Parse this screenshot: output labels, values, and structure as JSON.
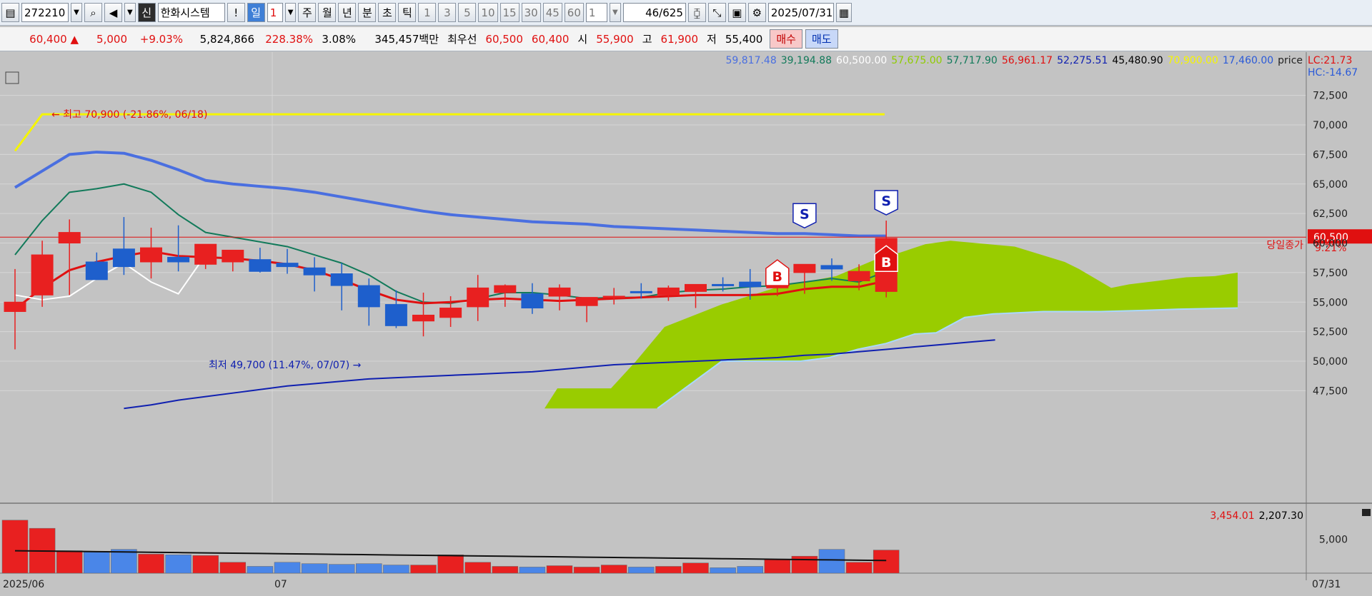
{
  "toolbar": {
    "code": "272210",
    "type_badge": "신",
    "stock_name": "한화시스템",
    "exclaim": "!",
    "period_active": "일",
    "period_count": "1",
    "periods": [
      "주",
      "월",
      "년",
      "분",
      "초",
      "틱"
    ],
    "intervals": [
      "1",
      "3",
      "5",
      "10",
      "15",
      "30",
      "45",
      "60"
    ],
    "interval_value": "1",
    "page_count": "46/625",
    "date": "2025/07/31"
  },
  "info": {
    "price": "60,400",
    "direction": "▲",
    "change": "5,000",
    "change_pct": "+9.03%",
    "volume": "5,824,866",
    "volume_ratio": "228.38%",
    "turnover_pct": "3.08%",
    "amount": "345,457백만",
    "preferred_label": "최우선",
    "ask": "60,500",
    "bid": "60,400",
    "open_label": "시",
    "open": "55,900",
    "high_label": "고",
    "high": "61,900",
    "low_label": "저",
    "low": "55,400",
    "buy_label": "매수",
    "sell_label": "매도"
  },
  "legend": {
    "values": [
      {
        "text": "59,817.48",
        "color": "#4a6fe0"
      },
      {
        "text": "39,194.88",
        "color": "#127a5a"
      },
      {
        "text": "60,500.00",
        "color": "#ffffff"
      },
      {
        "text": "57,675.00",
        "color": "#8fcc00"
      },
      {
        "text": "57,717.90",
        "color": "#127a5a"
      },
      {
        "text": "56,961.17",
        "color": "#e01010"
      },
      {
        "text": "52,275.51",
        "color": "#1020b0"
      },
      {
        "text": "45,480.90",
        "color": "#000000"
      },
      {
        "text": "70,900.00",
        "color": "#f5f500"
      },
      {
        "text": "17,460.00",
        "color": "#2a5ad8"
      }
    ],
    "price_label": "price",
    "lc": "LC:21.73",
    "hc": "HC:-14.67"
  },
  "chart_data": [
    {
      "type": "candlestick",
      "x_labels": [
        "2025/06",
        "07",
        "07/31"
      ],
      "ylim": [
        46000,
        73500
      ],
      "yticks": [
        "72,500",
        "70,000",
        "67,500",
        "65,000",
        "62,500",
        "60,000",
        "57,500",
        "55,000",
        "52,500",
        "50,000",
        "47,500"
      ],
      "candles": [
        {
          "o": 54200,
          "h": 57800,
          "l": 51000,
          "c": 55000
        },
        {
          "o": 55600,
          "h": 60200,
          "l": 54600,
          "c": 59000
        },
        {
          "o": 60000,
          "h": 62000,
          "l": 55600,
          "c": 60900
        },
        {
          "o": 58400,
          "h": 59200,
          "l": 57200,
          "c": 56900
        },
        {
          "o": 59500,
          "h": 62200,
          "l": 57300,
          "c": 58000
        },
        {
          "o": 58400,
          "h": 61300,
          "l": 57000,
          "c": 59600
        },
        {
          "o": 58800,
          "h": 61500,
          "l": 57600,
          "c": 58400
        },
        {
          "o": 58200,
          "h": 59600,
          "l": 57800,
          "c": 59900
        },
        {
          "o": 58400,
          "h": 59400,
          "l": 57600,
          "c": 59400
        },
        {
          "o": 58600,
          "h": 59600,
          "l": 57500,
          "c": 57600
        },
        {
          "o": 58300,
          "h": 59500,
          "l": 57400,
          "c": 58000
        },
        {
          "o": 57900,
          "h": 58800,
          "l": 55900,
          "c": 57300
        },
        {
          "o": 57400,
          "h": 58300,
          "l": 54300,
          "c": 56400
        },
        {
          "o": 56400,
          "h": 57000,
          "l": 53000,
          "c": 54600
        },
        {
          "o": 54800,
          "h": 56000,
          "l": 52800,
          "c": 53000
        },
        {
          "o": 53400,
          "h": 55800,
          "l": 52100,
          "c": 53900
        },
        {
          "o": 53700,
          "h": 55500,
          "l": 52900,
          "c": 54500
        },
        {
          "o": 54600,
          "h": 57300,
          "l": 53400,
          "c": 56200
        },
        {
          "o": 55800,
          "h": 56500,
          "l": 54600,
          "c": 56400
        },
        {
          "o": 55700,
          "h": 56600,
          "l": 54000,
          "c": 54500
        },
        {
          "o": 55500,
          "h": 56500,
          "l": 54300,
          "c": 56200
        },
        {
          "o": 54700,
          "h": 55200,
          "l": 53300,
          "c": 55400
        },
        {
          "o": 55400,
          "h": 56200,
          "l": 54800,
          "c": 55500
        },
        {
          "o": 55900,
          "h": 56600,
          "l": 55300,
          "c": 55800
        },
        {
          "o": 55600,
          "h": 56400,
          "l": 55100,
          "c": 56200
        },
        {
          "o": 55900,
          "h": 56300,
          "l": 54500,
          "c": 56500
        },
        {
          "o": 56500,
          "h": 57100,
          "l": 55900,
          "c": 56400
        },
        {
          "o": 56700,
          "h": 57800,
          "l": 55200,
          "c": 56300
        },
        {
          "o": 56200,
          "h": 57600,
          "l": 55500,
          "c": 57400
        },
        {
          "o": 57500,
          "h": 58000,
          "l": 55700,
          "c": 58200
        },
        {
          "o": 58100,
          "h": 58700,
          "l": 56800,
          "c": 57800
        },
        {
          "o": 56800,
          "h": 58200,
          "l": 56000,
          "c": 57600
        },
        {
          "o": 55900,
          "h": 61900,
          "l": 55400,
          "c": 60400
        }
      ]
    },
    {
      "type": "bar",
      "title": "volume",
      "legend": [
        {
          "text": "3,454.01",
          "color": "#e01010"
        },
        {
          "text": "2,207.30",
          "color": "#000000"
        }
      ],
      "ytick": "5,000",
      "values": [
        7800,
        6600,
        3300,
        3100,
        3500,
        2800,
        2700,
        2600,
        1600,
        1000,
        1600,
        1400,
        1300,
        1400,
        1200,
        1200,
        2700,
        1600,
        1000,
        900,
        1100,
        900,
        1200,
        900,
        1000,
        1500,
        800,
        1000,
        2000,
        2500,
        3500,
        1600,
        3400
      ],
      "colors_up": true
    }
  ],
  "annotations": {
    "high_label": "최고 70,900 (-21.86%, 06/18)",
    "low_label": "최저 49,700 (11.47%, 07/07)",
    "close_label": "당일종가",
    "close_pct": "9.21%",
    "price_tag": "60,500",
    "signal_buy": "B",
    "signal_sell": "S"
  }
}
